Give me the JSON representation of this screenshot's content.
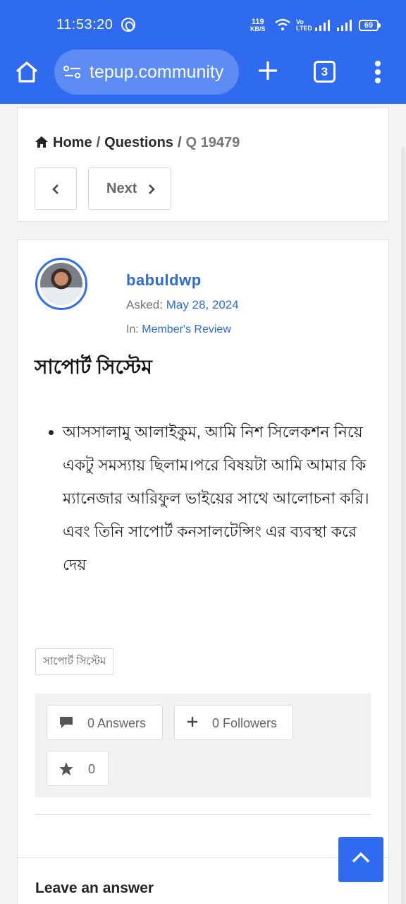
{
  "status_bar": {
    "time": "11:53:20",
    "net_speed_value": "119",
    "net_speed_unit": "KB/S",
    "volte_top": "Vo",
    "volte_bottom": "LTED",
    "battery": "69"
  },
  "browser": {
    "url": "tepup.community",
    "tab_count": "3"
  },
  "breadcrumb": {
    "home": "Home",
    "separator": "/",
    "questions": "Questions",
    "current": "Q 19479"
  },
  "pager": {
    "next_label": "Next"
  },
  "question": {
    "author": "babuldwp",
    "asked_label": "Asked: ",
    "asked_date": "May 28, 2024",
    "in_label": "In: ",
    "category": "Member's Review",
    "title": "সাপোর্ট সিস্টেম",
    "body_items": [
      "আসসালামু আলাইকুম, আমি নিশ সিলেকশন নিয়ে একটু সমস্যায় ছিলাম।পরে বিষয়টা আমি আমার কি ম্যানেজার আরিফুল ভাইয়ের সাথে আলোচনা করি। এবং তিনি সাপোর্ট কনসালটেন্সিং এর ব্যবস্থা করে দেয়"
    ],
    "tag": "সাপোর্ট সিস্টেম"
  },
  "stats": {
    "answers": "0 Answers",
    "followers": "0 Followers",
    "favorites": "0"
  },
  "answer_section": {
    "heading": "Leave an answer"
  },
  "colors": {
    "accent": "#2f6bf0",
    "link": "#2f6bd8",
    "background": "#f3f3f3"
  }
}
